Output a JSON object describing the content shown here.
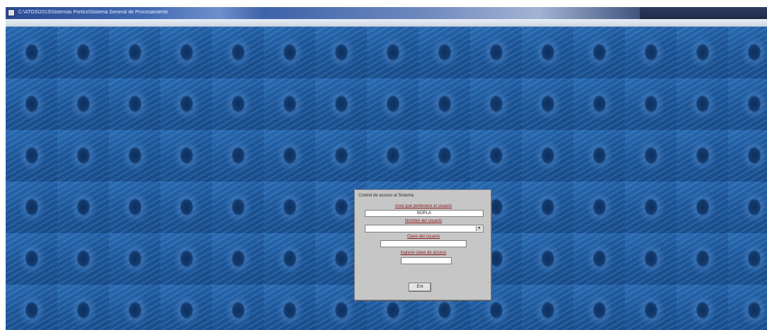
{
  "window": {
    "title": "C:\\ATOS\\2013\\Sistemas Portico\\Sistema General de Procesamiento",
    "icon": "app-icon"
  },
  "login": {
    "title": "Control de acceso al Sistema",
    "area_label": "Area que pertenece el usuario",
    "area_value": "BOPLA",
    "user_label": "Nombre del usuario",
    "user_value": "",
    "password_label": "Clave del usuario",
    "password_value": "",
    "access_code_label": "Ingrese clave de acceso",
    "access_code_value": "",
    "enter_label": "Ent"
  },
  "colors": {
    "desktop": "#1b4f8e",
    "dialog": "#c6c6c6",
    "label": "#8b1a1a"
  }
}
